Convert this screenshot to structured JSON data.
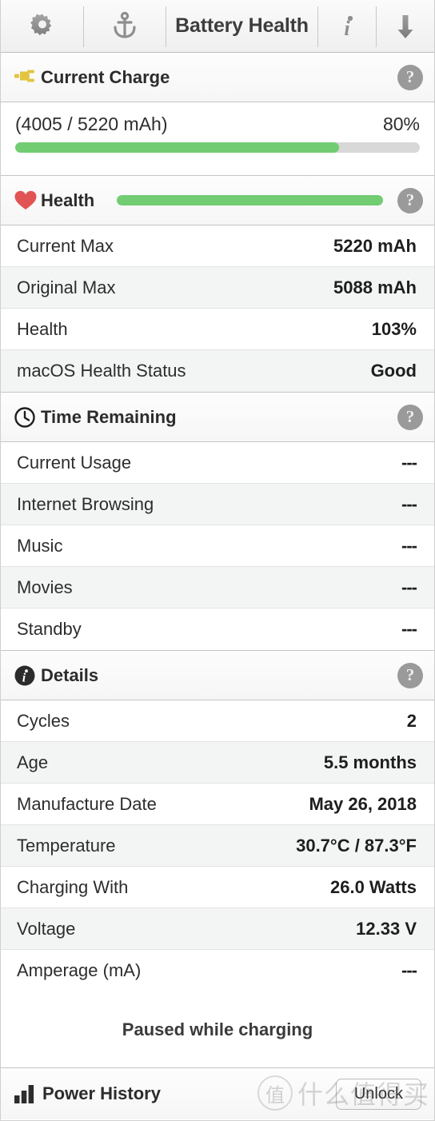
{
  "toolbar": {
    "title": "Battery Health",
    "gear_icon": "gear-icon",
    "anchor_icon": "anchor-icon",
    "info_icon": "info-icon",
    "download_icon": "download-arrow-icon"
  },
  "colors": {
    "green": "#72cd72",
    "track": "#d8d8d8",
    "heart_red": "#e25454",
    "plug_yellow": "#e3c43f",
    "help_grey": "#9a9a9a"
  },
  "current_charge": {
    "title": "Current Charge",
    "icon": "power-plug-icon",
    "help": "?",
    "capacity_text": "(4005 / 5220 mAh)",
    "percent_text": "80%",
    "percent_value": 80
  },
  "health": {
    "title": "Health",
    "icon": "heart-icon",
    "help": "?",
    "bar_percent": 100,
    "rows": [
      {
        "label": "Current Max",
        "value": "5220 mAh"
      },
      {
        "label": "Original Max",
        "value": "5088 mAh"
      },
      {
        "label": "Health",
        "value": "103%"
      },
      {
        "label": "macOS Health Status",
        "value": "Good"
      }
    ]
  },
  "time_remaining": {
    "title": "Time Remaining",
    "icon": "clock-icon",
    "help": "?",
    "rows": [
      {
        "label": "Current Usage",
        "value": "---"
      },
      {
        "label": "Internet Browsing",
        "value": "---"
      },
      {
        "label": "Music",
        "value": "---"
      },
      {
        "label": "Movies",
        "value": "---"
      },
      {
        "label": "Standby",
        "value": "---"
      }
    ]
  },
  "details": {
    "title": "Details",
    "icon": "info-circle-icon",
    "help": "?",
    "rows": [
      {
        "label": "Cycles",
        "value": "2"
      },
      {
        "label": "Age",
        "value": "5.5 months"
      },
      {
        "label": "Manufacture Date",
        "value": "May 26, 2018"
      },
      {
        "label": "Temperature",
        "value": "30.7°C / 87.3°F"
      },
      {
        "label": "Charging With",
        "value": "26.0 Watts"
      },
      {
        "label": "Voltage",
        "value": "12.33 V"
      },
      {
        "label": "Amperage (mA)",
        "value": "---"
      }
    ]
  },
  "status_note": "Paused while charging",
  "footer": {
    "title": "Power History",
    "icon": "bar-chart-icon",
    "unlock_label": "Unlock"
  },
  "watermark": {
    "mark": "值",
    "text": "什么值得买"
  }
}
